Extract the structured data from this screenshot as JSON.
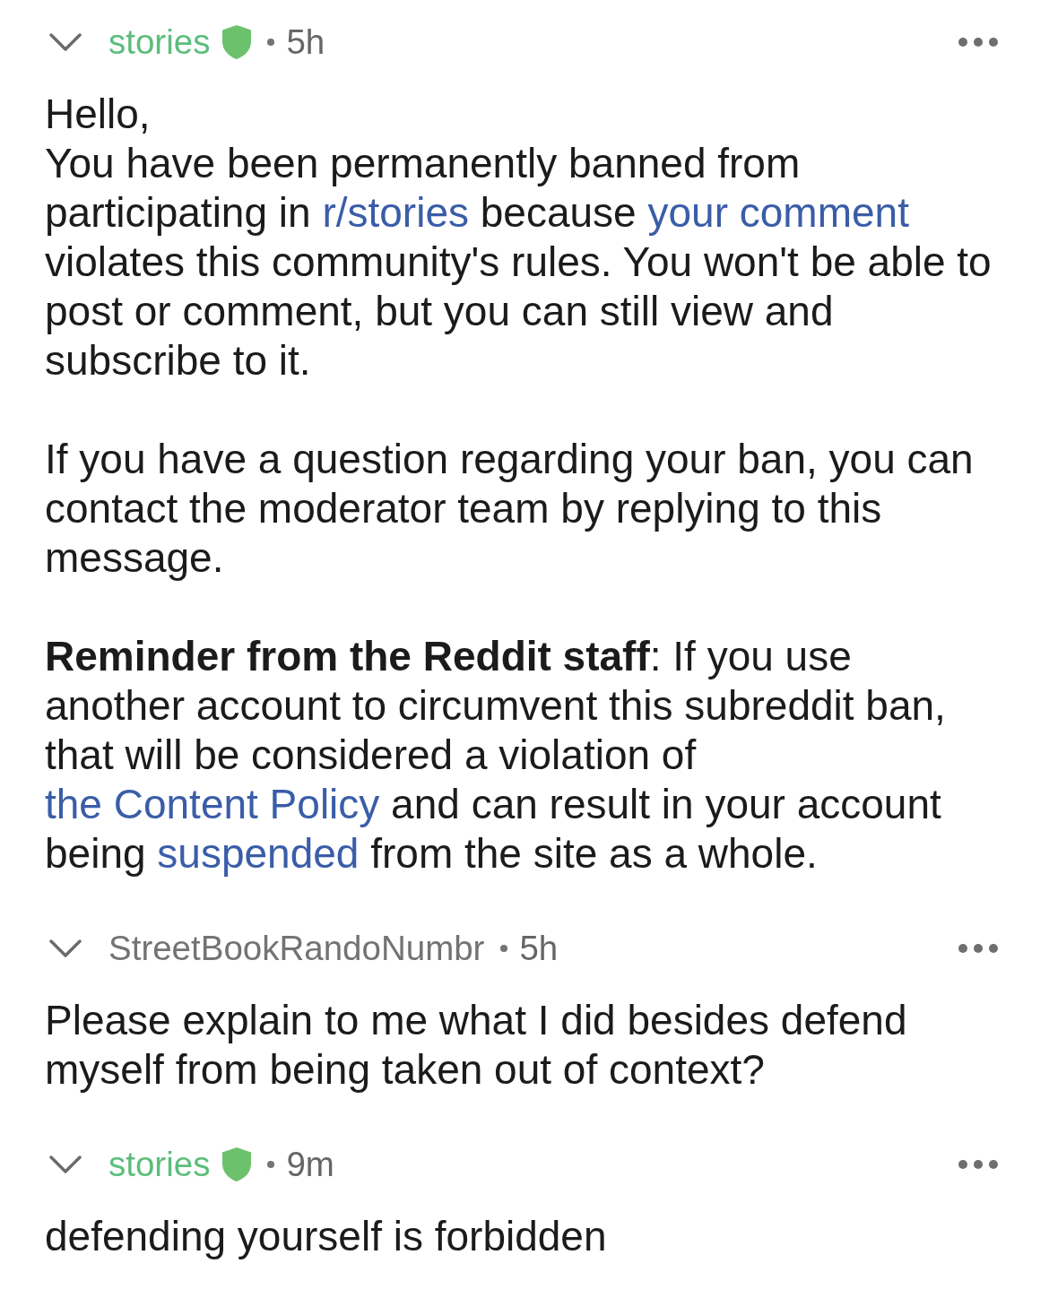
{
  "comments": [
    {
      "author": "stories",
      "moderator": true,
      "time": "5h",
      "expanded": true,
      "paragraphs": [
        [
          {
            "text": "Hello,\nYou have been permanently banned from participating in ",
            "link": false
          },
          {
            "text": "r/stories",
            "link": true
          },
          {
            "text": " because ",
            "link": false
          },
          {
            "text": "your comment",
            "link": true
          },
          {
            "text": " violates this community's rules. You won't be able to post or comment, but you can still view and subscribe to it.",
            "link": false
          }
        ],
        [
          {
            "text": "If you have a question regarding your ban, you can contact the moderator team by replying to this message.",
            "link": false
          }
        ],
        [
          {
            "text": "**Reminder from the Reddit staff**: If you use another account to circumvent this subreddit ban, that will be considered a violation of ",
            "link": false
          },
          {
            "text": "the Content Policy",
            "link": true
          },
          {
            "text": " and can result in your account being ",
            "link": false
          },
          {
            "text": "suspended",
            "link": true
          },
          {
            "text": " from the site as a whole.",
            "link": false
          }
        ]
      ]
    },
    {
      "author": "StreetBookRandoNumbr",
      "moderator": false,
      "time": "5h",
      "expanded": true,
      "paragraphs": [
        [
          {
            "text": "Please explain to me what I did besides defend myself from being taken out of context?",
            "link": false
          }
        ]
      ]
    },
    {
      "author": "stories",
      "moderator": true,
      "time": "9m",
      "expanded": true,
      "paragraphs": [
        [
          {
            "text": "defending yourself is forbidden",
            "link": false
          }
        ]
      ]
    }
  ]
}
